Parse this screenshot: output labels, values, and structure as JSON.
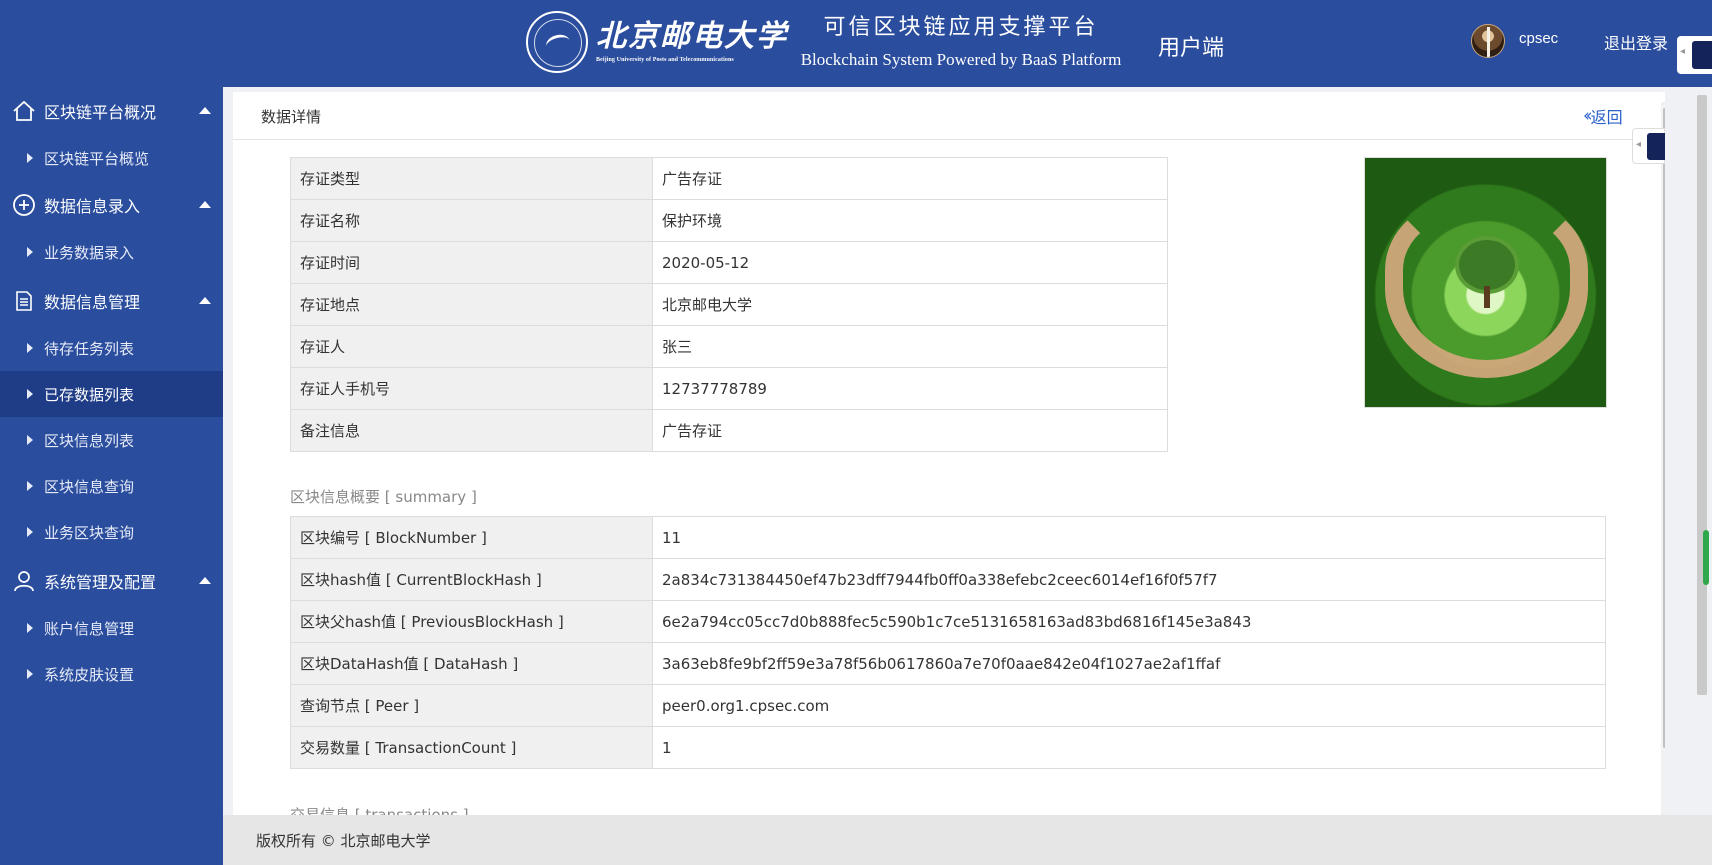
{
  "header": {
    "university_cn": "北京邮电大学",
    "university_en": "Beijing University of Posts and Telecommunications",
    "platform_cn": "可信区块链应用支撑平台",
    "platform_en": "Blockchain System Powered by BaaS Platform",
    "client_label": "用户端",
    "username": "cpsec",
    "logout": "退出登录"
  },
  "sidebar": {
    "groups": [
      {
        "label": "区块链平台概况",
        "icon": "home-icon",
        "items": [
          {
            "label": "区块链平台概览"
          }
        ]
      },
      {
        "label": "数据信息录入",
        "icon": "plus-circle-icon",
        "items": [
          {
            "label": "业务数据录入"
          }
        ]
      },
      {
        "label": "数据信息管理",
        "icon": "document-icon",
        "items": [
          {
            "label": "待存任务列表"
          },
          {
            "label": "已存数据列表",
            "active": true
          },
          {
            "label": "区块信息列表"
          },
          {
            "label": "区块信息查询"
          },
          {
            "label": "业务区块查询"
          }
        ]
      },
      {
        "label": "系统管理及配置",
        "icon": "user-icon",
        "items": [
          {
            "label": "账户信息管理"
          },
          {
            "label": "系统皮肤设置"
          }
        ]
      }
    ]
  },
  "main": {
    "title": "数据详情",
    "back_label": "返回",
    "evidence": {
      "rows": [
        {
          "key": "存证类型",
          "value": "广告存证"
        },
        {
          "key": "存证名称",
          "value": "保护环境"
        },
        {
          "key": "存证时间",
          "value": "2020-05-12"
        },
        {
          "key": "存证地点",
          "value": "北京邮电大学"
        },
        {
          "key": "存证人",
          "value": "张三"
        },
        {
          "key": "存证人手机号",
          "value": "12737778789"
        },
        {
          "key": "备注信息",
          "value": "广告存证"
        }
      ]
    },
    "summary": {
      "title": "区块信息概要 [ summary ]",
      "rows": [
        {
          "key": "区块编号 [ BlockNumber ]",
          "value": "11"
        },
        {
          "key": "区块hash值 [ CurrentBlockHash ]",
          "value": "2a834c731384450ef47b23dff7944fb0ff0a338efebc2ceec6014ef16f0f57f7"
        },
        {
          "key": "区块父hash值 [ PreviousBlockHash ]",
          "value": "6e2a794cc05cc7d0b888fec5c590b1c7ce5131658163ad83bd6816f145e3a843"
        },
        {
          "key": "区块DataHash值 [ DataHash ]",
          "value": "3a63eb8fe9bf2ff59e3a78f56b0617860a7e70f0aae842e04f1027ae2af1ffaf"
        },
        {
          "key": "查询节点 [ Peer ]",
          "value": "peer0.org1.cpsec.com"
        },
        {
          "key": "交易数量 [ TransactionCount ]",
          "value": "1"
        }
      ]
    },
    "transactions_title": "交易信息 [ transactions ]"
  },
  "footer": {
    "copyright": "版权所有 © 北京邮电大学"
  },
  "colors": {
    "primary": "#2a4d9e",
    "active_item": "#1f3d86",
    "link": "#2a62c9"
  }
}
